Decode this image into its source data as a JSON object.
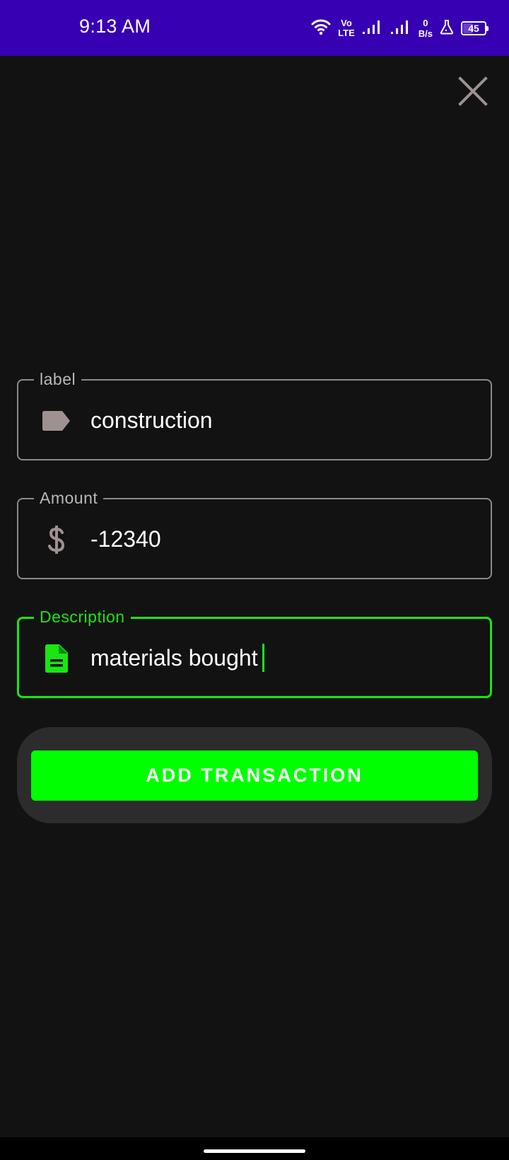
{
  "status_bar": {
    "time": "9:13 AM",
    "volte_top": "Vo",
    "volte_bottom": "LTE",
    "net_speed_value": "0",
    "net_speed_unit": "B/s",
    "battery_level": "45",
    "background_color": "#3700b3"
  },
  "form": {
    "label_field": {
      "label": "label",
      "value": "construction",
      "icon": "tag-icon"
    },
    "amount_field": {
      "label": "Amount",
      "value": "-12340",
      "icon": "dollar-icon"
    },
    "description_field": {
      "label": "Description",
      "value": "materials bought",
      "icon": "document-icon",
      "focused": true
    },
    "submit_label": "ADD TRANSACTION"
  },
  "colors": {
    "accent": "#00ff00",
    "focus_border": "#19e614",
    "background": "#121212",
    "card": "#2c2c2c",
    "icon_gray": "#9e9191"
  },
  "icons": {
    "close": "close-icon"
  }
}
